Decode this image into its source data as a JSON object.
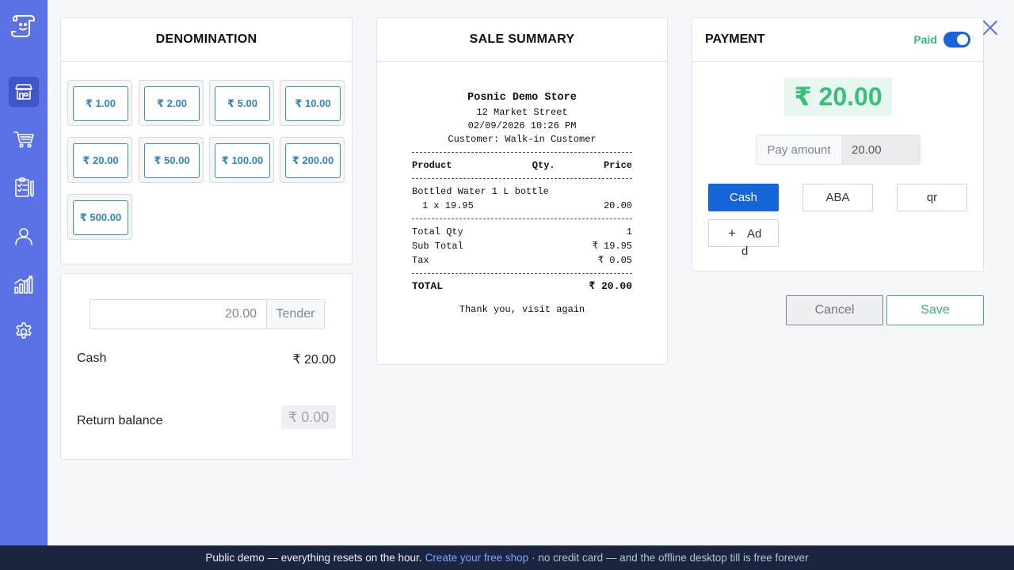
{
  "denomination": {
    "title": "DENOMINATION",
    "buttons": [
      "₹ 1.00",
      "₹ 2.00",
      "₹ 5.00",
      "₹ 10.00",
      "₹ 20.00",
      "₹ 50.00",
      "₹ 100.00",
      "₹ 200.00",
      "₹ 500.00"
    ]
  },
  "tender": {
    "input_value": "20.00",
    "button_label": "Tender",
    "cash_label": "Cash",
    "cash_value": "₹ 20.00",
    "return_label": "Return balance",
    "return_value": "₹ 0.00"
  },
  "sale_summary": {
    "title": "SALE SUMMARY",
    "store_name": "Posnic Demo Store",
    "address": "12 Market Street",
    "datetime": "02/09/2026 10:26 PM",
    "customer": "Customer: Walk-in Customer",
    "col_product": "Product",
    "col_qty": "Qty.",
    "col_price": "Price",
    "item_name": "Bottled Water 1 L bottle",
    "item_qty_line": "1 x 19.95",
    "item_price": "20.00",
    "total_qty_label": "Total Qty",
    "total_qty_value": "1",
    "subtotal_label": "Sub Total",
    "subtotal_value": "₹ 19.95",
    "tax_label": "Tax",
    "tax_value": "₹ 0.05",
    "total_label": "TOTAL",
    "total_value": "₹ 20.00",
    "footer": "Thank you, visit again"
  },
  "payment": {
    "title": "PAYMENT",
    "paid_label": "Paid",
    "paid_on": true,
    "amount": "₹ 20.00",
    "pay_amount_label": "Pay amount",
    "pay_amount_value": "20.00",
    "methods": [
      "Cash",
      "ABA",
      "qr"
    ],
    "add_label_1": "Ad",
    "add_label_2": "d",
    "add_plus": "+"
  },
  "actions": {
    "cancel_label": "Cancel",
    "save_label": "Save"
  },
  "banner": {
    "lead": "Public demo — everything resets on the hour.",
    "link": "Create your free shop",
    "tail": "· no credit card — and the offline desktop till is free forever"
  },
  "colors": {
    "sidebar": "#5a72e6",
    "primary": "#1565d8",
    "success": "#36b36e",
    "denom_text": "#2c86c2"
  },
  "icons": [
    "logo-icon",
    "store-icon",
    "cart-icon",
    "checklist-icon",
    "user-icon",
    "chart-icon",
    "gear-icon",
    "close-icon"
  ]
}
